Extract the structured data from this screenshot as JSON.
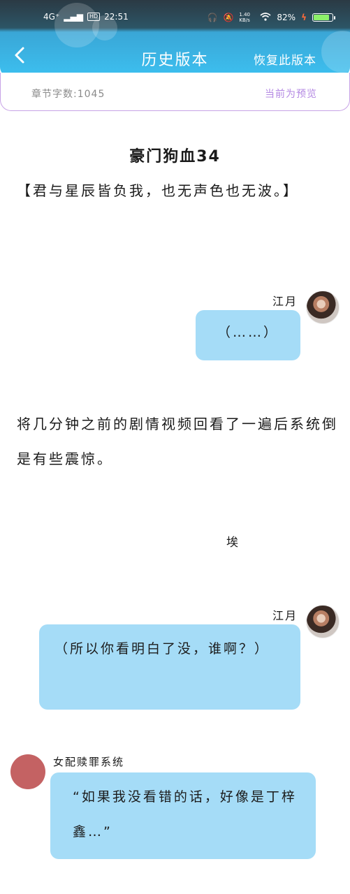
{
  "status_bar": {
    "network": "4G⁺",
    "hd": "HD",
    "time": "22:51",
    "speed": "1.40 KB/s",
    "battery": "82%"
  },
  "header": {
    "title": "历史版本",
    "restore_label": "恢复此版本"
  },
  "info": {
    "word_count": "章节字数:1045",
    "preview_status": "当前为预览"
  },
  "content": {
    "chapter_title": "豪门狗血34",
    "para1": "【君与星辰皆负我，也无声色也无波。】",
    "bubble1": {
      "name": "江月",
      "text": "（……）"
    },
    "para2": "将几分钟之前的剧情视频回看了一遍后系统倒是有些震惊。",
    "interjection": "埃",
    "bubble2": {
      "name": "江月",
      "text": "（所以你看明白了没，谁啊？）"
    },
    "bubble3": {
      "name": "女配赎罪系统",
      "text": "“如果我没看错的话，好像是丁梓鑫…”"
    }
  }
}
